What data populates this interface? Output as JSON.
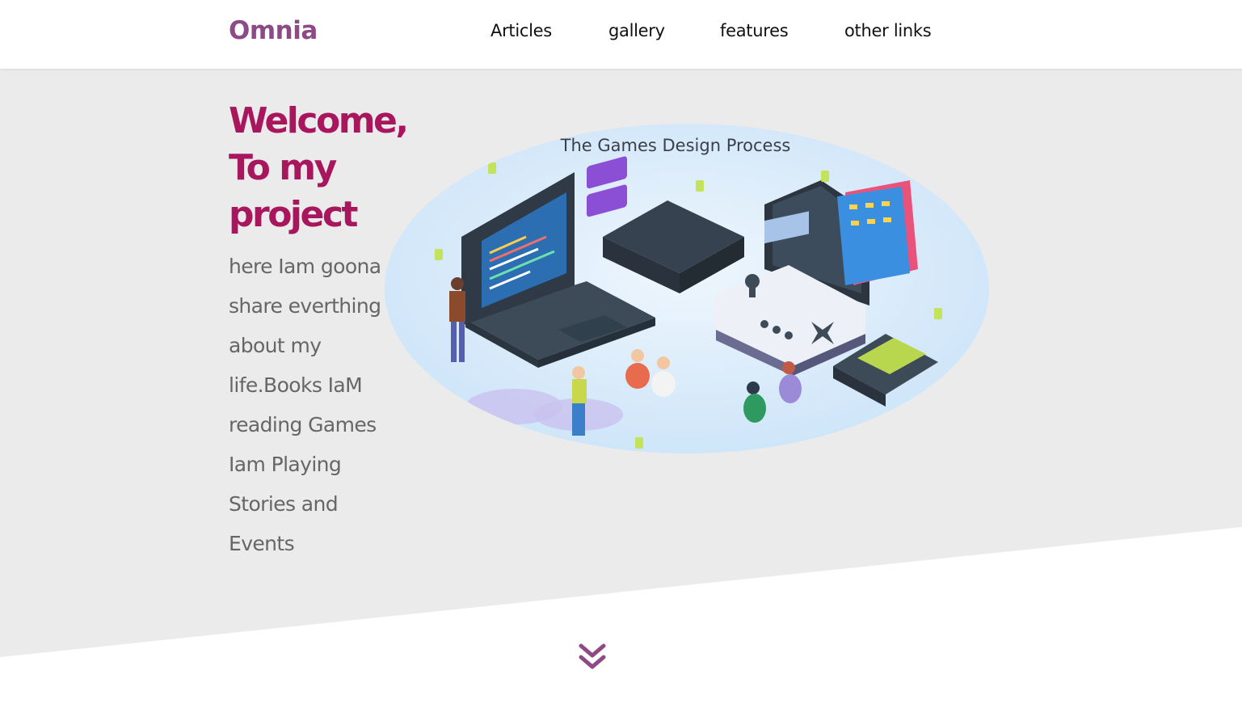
{
  "header": {
    "logo": "Omnia",
    "nav": [
      {
        "label": "Articles"
      },
      {
        "label": "gallery"
      },
      {
        "label": "features"
      },
      {
        "label": "other links"
      }
    ]
  },
  "landing": {
    "heading_lines": [
      "Welcome,",
      "To my",
      "project"
    ],
    "intro_lines": [
      "here Iam goona",
      "share everthing",
      "about my",
      "life.Books IaM",
      "reading Games",
      "Iam Playing",
      "Stories and",
      "Events"
    ],
    "illustration": {
      "caption": "The Games Design Process",
      "icon": "game-design-illustration"
    },
    "scroll_icon": "double-chevron-down-icon"
  },
  "colors": {
    "brand": "#8e4a87",
    "heading": "#a8175e",
    "landing_bg": "#ebebeb",
    "text": "#666666"
  }
}
